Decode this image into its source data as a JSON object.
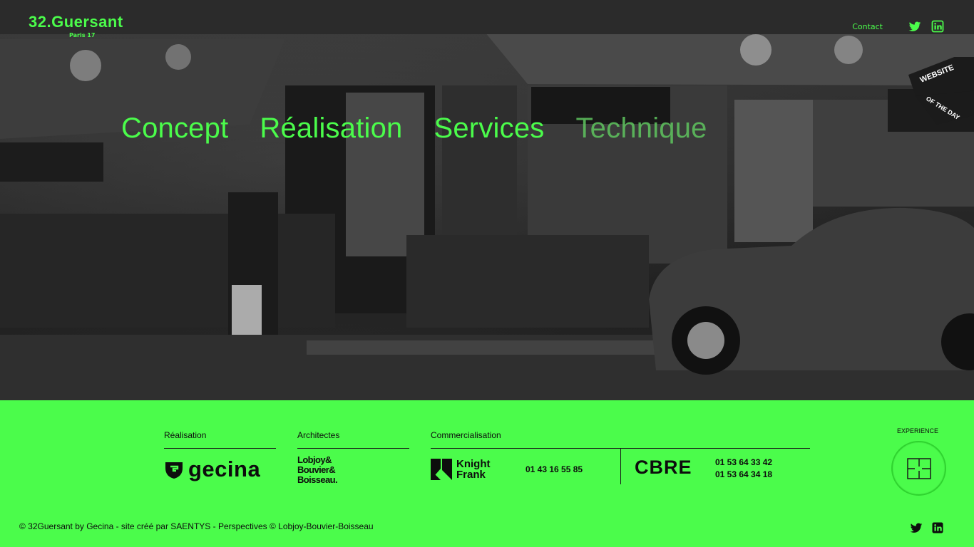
{
  "header": {
    "brand_name": "32.Guersant",
    "brand_sub": "Paris 17",
    "contact_label": "Contact",
    "social_icons": [
      "twitter-icon",
      "linkedin-icon"
    ],
    "badge_top": "WEBSITE",
    "badge_bottom": "OF THE DAY"
  },
  "nav": {
    "items": [
      {
        "label": "Concept"
      },
      {
        "label": "Réalisation"
      },
      {
        "label": "Services"
      },
      {
        "label": "Technique"
      }
    ]
  },
  "footer": {
    "realisation": {
      "title": "Réalisation",
      "logo": "gecina"
    },
    "architectes": {
      "title": "Architectes",
      "logo_lines": [
        "Lobjoy&",
        "Bouvier&",
        "Boisseau."
      ]
    },
    "commercialisation": {
      "title": "Commercialisation",
      "knight_frank": {
        "logo_lines": [
          "Knight",
          "Frank"
        ],
        "phone": "01 43 16 55 85"
      },
      "cbre": {
        "logo": "CBRE",
        "phones": [
          "01 53 64 33 42",
          "01 53 64 34 18"
        ]
      }
    },
    "experience_label": "EXPERIENCE",
    "copyright": "© 32Guersant by Gecina - site créé par SAENTYS - Perspectives © Lobjoy-Bouvier-Boisseau"
  },
  "colors": {
    "accent": "#4bfc4b",
    "dark": "#0d0d0d"
  }
}
